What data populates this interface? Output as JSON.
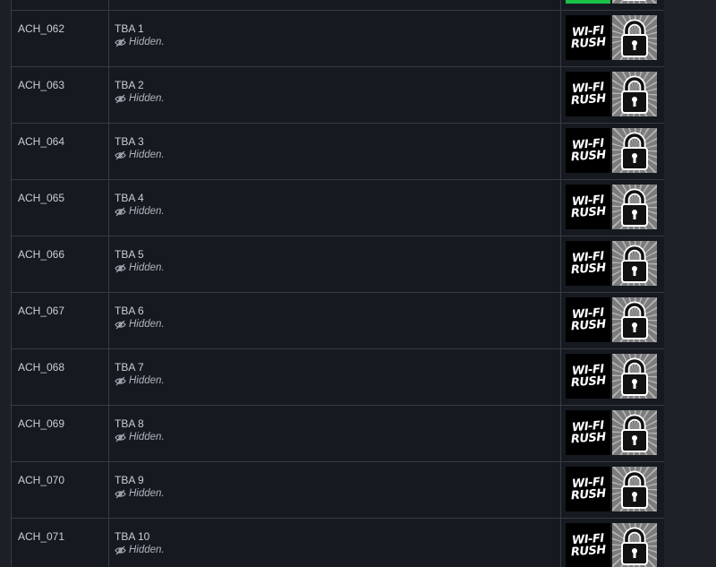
{
  "rows": [
    {
      "id": "",
      "name": "",
      "status": ""
    },
    {
      "id": "ACH_062",
      "name": "TBA 1",
      "status": "Hidden."
    },
    {
      "id": "ACH_063",
      "name": "TBA 2",
      "status": "Hidden."
    },
    {
      "id": "ACH_064",
      "name": "TBA 3",
      "status": "Hidden."
    },
    {
      "id": "ACH_065",
      "name": "TBA 4",
      "status": "Hidden."
    },
    {
      "id": "ACH_066",
      "name": "TBA 5",
      "status": "Hidden."
    },
    {
      "id": "ACH_067",
      "name": "TBA 6",
      "status": "Hidden."
    },
    {
      "id": "ACH_068",
      "name": "TBA 7",
      "status": "Hidden."
    },
    {
      "id": "ACH_069",
      "name": "TBA 8",
      "status": "Hidden."
    },
    {
      "id": "ACH_070",
      "name": "TBA 9",
      "status": "Hidden."
    },
    {
      "id": "ACH_071",
      "name": "TBA 10",
      "status": "Hidden."
    }
  ],
  "icons": {
    "unlocked": "wifi-rush-logo-icon",
    "locked": "padlock-icon",
    "hidden": "eye-slash-icon"
  },
  "logo_lines": [
    "WI-FI",
    "RUSH"
  ],
  "colors": {
    "background": "#1c1f25",
    "border": "#353b45",
    "text": "#c9ced6",
    "partial_icon_green": "#19c246"
  }
}
